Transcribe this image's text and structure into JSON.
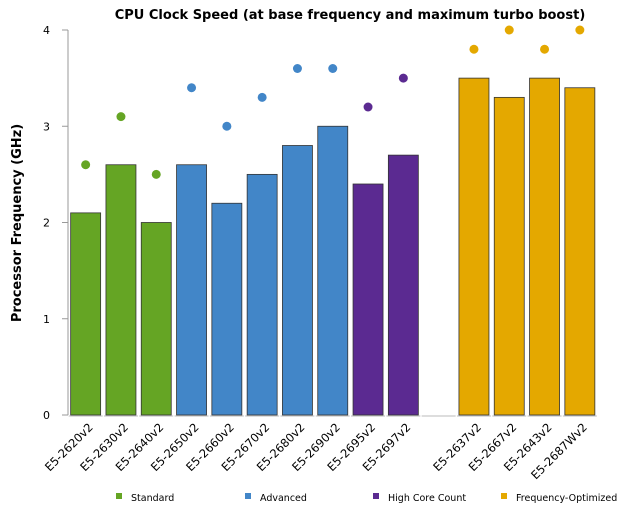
{
  "chart_data": {
    "type": "bar",
    "title": "CPU Clock Speed (at base frequency and maximum turbo boost)",
    "xlabel": "",
    "ylabel": "Processor Frequency (GHz)",
    "ylim": [
      0,
      4
    ],
    "yticks": [
      "0",
      "1",
      "2",
      "3",
      "4"
    ],
    "grid": false,
    "legend_position": "bottom",
    "categories": [
      "E5-2620v2",
      "E5-2630v2",
      "E5-2640v2",
      "E5-2650v2",
      "E5-2660v2",
      "E5-2670v2",
      "E5-2680v2",
      "E5-2690v2",
      "E5-2695v2",
      "E5-2697v2",
      "",
      "E5-2637v2",
      "E5-2667v2",
      "E5-2643v2",
      "E5-2687Wv2"
    ],
    "groups": [
      "Standard",
      "Standard",
      "Standard",
      "Advanced",
      "Advanced",
      "Advanced",
      "Advanced",
      "Advanced",
      "High Core Count",
      "High Core Count",
      null,
      "Frequency-Optimized",
      "Frequency-Optimized",
      "Frequency-Optimized",
      "Frequency-Optimized"
    ],
    "base_frequency": [
      2.1,
      2.6,
      2.0,
      2.6,
      2.2,
      2.5,
      2.8,
      3.0,
      2.4,
      2.7,
      null,
      3.5,
      3.3,
      3.5,
      3.4
    ],
    "turbo_frequency": [
      2.6,
      3.1,
      2.5,
      3.4,
      3.0,
      3.3,
      3.6,
      3.6,
      3.2,
      3.5,
      null,
      3.8,
      4.0,
      3.8,
      4.0
    ],
    "legend": [
      {
        "name": "Standard",
        "color": "#65a524"
      },
      {
        "name": "Advanced",
        "color": "#4286c8"
      },
      {
        "name": "High Core Count",
        "color": "#5b2a91"
      },
      {
        "name": "Frequency-Optimized",
        "color": "#e4a800"
      }
    ]
  }
}
